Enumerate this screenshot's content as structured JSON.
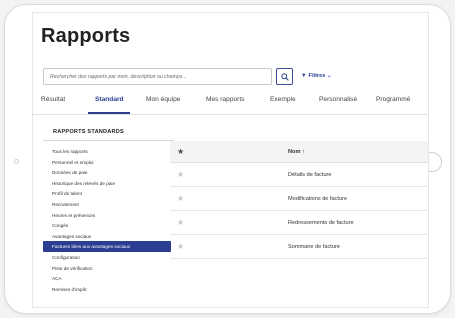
{
  "page": {
    "title": "Rapports"
  },
  "search": {
    "placeholder": "Rechercher des rapports par nom, description ou champs..."
  },
  "filters": {
    "label": "Filtres",
    "icon": "funnel-icon",
    "chevron": "⌄"
  },
  "tabs": [
    {
      "label": "Résultat"
    },
    {
      "label": "Standard",
      "active": true
    },
    {
      "label": "Mon équipe"
    },
    {
      "label": "Mes rapports"
    },
    {
      "label": "Exemple"
    },
    {
      "label": "Personnalisé"
    },
    {
      "label": "Programmé"
    }
  ],
  "sidebar": {
    "heading": "RAPPORTS STANDARDS",
    "items": [
      {
        "label": "Tous les rapports"
      },
      {
        "label": "Personnel et emploi"
      },
      {
        "label": "Données de paie"
      },
      {
        "label": "Historique des relevés de paie"
      },
      {
        "label": "Profil de talent"
      },
      {
        "label": "Recrutement"
      },
      {
        "label": "Heures et présences"
      },
      {
        "label": "Congés"
      },
      {
        "label": "Avantages sociaux"
      },
      {
        "label": "Factures liées aux avantages sociaux",
        "active": true
      },
      {
        "label": "Configuration"
      },
      {
        "label": "Piste de vérification"
      },
      {
        "label": "ACA"
      },
      {
        "label": "Remises d'impôt"
      }
    ]
  },
  "table": {
    "header": {
      "name": "Nom ↑",
      "star": "★"
    },
    "rows": [
      {
        "name": "Détails de facture",
        "star": "★"
      },
      {
        "name": "Modifications de facture",
        "star": "★"
      },
      {
        "name": "Redressements de facture",
        "star": "★"
      },
      {
        "name": "Sommaire de facture",
        "star": "★"
      }
    ]
  },
  "colors": {
    "accent": "#2c3e91",
    "text": "#333333",
    "header_bg": "#f4f4f4"
  }
}
